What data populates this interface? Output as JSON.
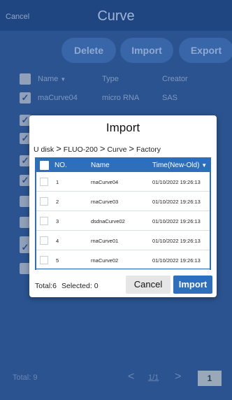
{
  "topbar": {
    "cancel_label": "Cancel",
    "title": "Curve"
  },
  "actions": {
    "delete_label": "Delete",
    "import_label": "Import",
    "export_label": "Export"
  },
  "list": {
    "columns": {
      "name": "Name",
      "sort_glyph": "▼",
      "type": "Type",
      "creator": "Creator"
    },
    "first_row": {
      "name": "maCurve04",
      "type": "micro RNA",
      "creator": "SAS"
    },
    "row_checked": [
      true,
      true,
      true,
      true,
      true,
      false,
      false,
      false,
      true,
      false
    ],
    "check_glyph": "✓"
  },
  "footer": {
    "total_label": "Total: 9",
    "page_indicator": "1/1",
    "page_box": "1",
    "prev_glyph": "<",
    "next_glyph": ">"
  },
  "modal": {
    "title": "Import",
    "breadcrumb": [
      "U disk",
      "FLUO-200",
      "Curve",
      "Factory"
    ],
    "breadcrumb_sep": ">",
    "table": {
      "headers": {
        "no": "NO.",
        "name": "Name",
        "time": "Time(New-Old)",
        "sort_glyph": "▼"
      },
      "rows": [
        {
          "no": "1",
          "name": "rnaCurve04",
          "time": "01/10/2022 19:26:13"
        },
        {
          "no": "2",
          "name": "rnaCurve03",
          "time": "01/10/2022 19:26:13"
        },
        {
          "no": "3",
          "name": "dsdnaCurve02",
          "time": "01/10/2022 19:26:13"
        },
        {
          "no": "4",
          "name": "rnaCurve01",
          "time": "01/10/2022 19:26:13"
        },
        {
          "no": "5",
          "name": "rnaCurve02",
          "time": "01/10/2022 19:26:13"
        }
      ]
    },
    "total_label": "Total:6",
    "selected_label": "Selected: 0",
    "cancel_label": "Cancel",
    "import_label": "Import"
  }
}
